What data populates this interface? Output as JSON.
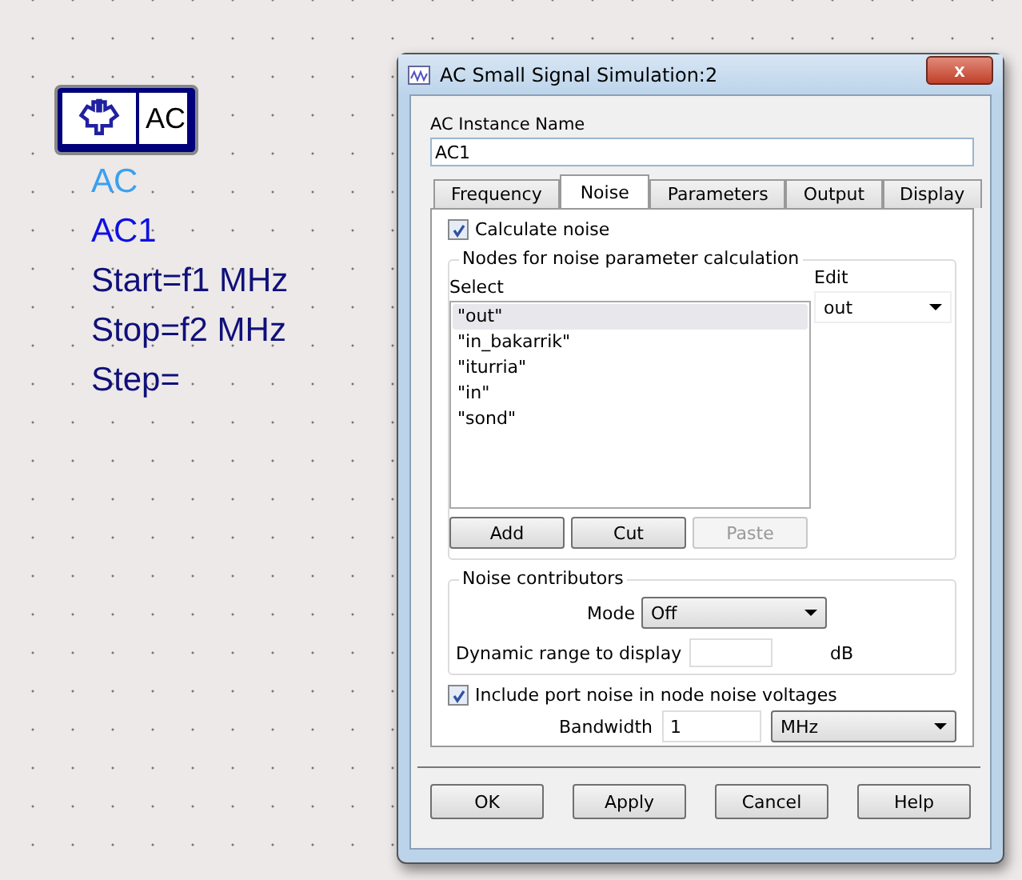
{
  "schematic": {
    "component_label": "AC",
    "lines": [
      {
        "text": "AC",
        "kind": "type"
      },
      {
        "text": "AC1",
        "kind": "name"
      },
      {
        "text": "Start=f1 MHz",
        "kind": "param"
      },
      {
        "text": "Stop=f2 MHz",
        "kind": "param"
      },
      {
        "text": "Step=",
        "kind": "param"
      }
    ]
  },
  "dialog": {
    "title": "AC Small Signal Simulation:2",
    "close": "x",
    "instance_label": "AC Instance Name",
    "instance_value": "AC1",
    "tabs": [
      {
        "label": "Frequency",
        "selected": false
      },
      {
        "label": "Noise",
        "selected": true
      },
      {
        "label": "Parameters",
        "selected": false
      },
      {
        "label": "Output",
        "selected": false
      },
      {
        "label": "Display",
        "selected": false
      }
    ],
    "calculate_noise": {
      "label": "Calculate noise",
      "checked": true
    },
    "nodes_group": {
      "title": "Nodes for noise parameter calculation",
      "select_label": "Select",
      "edit_label": "Edit",
      "edit_value": "out",
      "items": [
        {
          "label": "\"out\"",
          "selected": true
        },
        {
          "label": "\"in_bakarrik\"",
          "selected": false
        },
        {
          "label": "\"iturria\"",
          "selected": false
        },
        {
          "label": "\"in\"",
          "selected": false
        },
        {
          "label": "\"sond\"",
          "selected": false
        }
      ],
      "buttons": [
        {
          "label": "Add",
          "disabled": false
        },
        {
          "label": "Cut",
          "disabled": false
        },
        {
          "label": "Paste",
          "disabled": true
        }
      ]
    },
    "contributors_group": {
      "title": "Noise contributors",
      "mode_label": "Mode",
      "mode_value": "Off",
      "range_label": "Dynamic range to display",
      "range_unit": "dB"
    },
    "include_port_noise": {
      "label": "Include port noise in node noise voltages",
      "checked": true
    },
    "bandwidth": {
      "label": "Bandwidth",
      "value": "1",
      "unit": "MHz"
    },
    "buttons": [
      {
        "label": "OK"
      },
      {
        "label": "Apply"
      },
      {
        "label": "Cancel"
      },
      {
        "label": "Help"
      }
    ]
  }
}
